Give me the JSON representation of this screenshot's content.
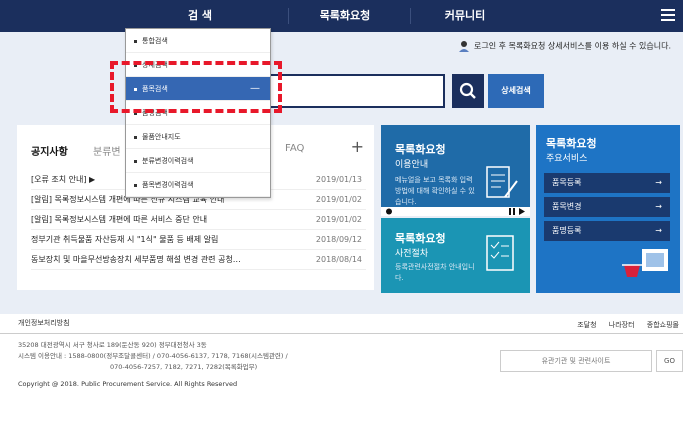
{
  "nav": {
    "items": [
      "검 색",
      "목록화요청",
      "커뮤니티"
    ]
  },
  "login_message": "로그인 후 목록화요청 상세서비스를 이용 하실 수 있습니다.",
  "search": {
    "detail_label": "상세검색"
  },
  "dropdown": {
    "items": [
      "통합검색",
      "상세검색",
      "품목검색",
      "품명검색",
      "물품안내지도",
      "분류변경이력검색",
      "품목변경이력검색"
    ],
    "active_index": 2
  },
  "notice": {
    "tab_active": "공지사항",
    "tab_other": "분류변",
    "tab_faq": "FAQ",
    "rows": [
      {
        "title": "[오류 조치 안내] ▶ ",
        "date": "2019/01/13"
      },
      {
        "title": "[알림] 목록정보시스템 개편에 따른 신규 시스템 교육 안내",
        "date": "2019/01/02"
      },
      {
        "title": "[알림] 목록정보시스템 개편에 따른 서비스 중단 안내",
        "date": "2019/01/02"
      },
      {
        "title": "정부기관 취득물품 자산등재 시 \"1식\" 물품 등 배제 알림",
        "date": "2018/09/12"
      },
      {
        "title": "동보장치 및 마을무선방송장치 세부품명 해설 변경 관련 공청…",
        "date": "2018/08/14"
      }
    ]
  },
  "cards": {
    "guide": {
      "title": "목록화요청",
      "sub": "이용안내",
      "desc": "메뉴얼을 보고 목록화 입력방법에 대해 확인하실 수 있습니다."
    },
    "procedure": {
      "title": "목록화요청",
      "sub": "사전절차",
      "desc": "등록관련사전절차 안내입니다."
    },
    "services": {
      "title": "목록화요청",
      "sub": "주요서비스",
      "buttons": [
        "품목등록",
        "품목변경",
        "품명등록"
      ],
      "arrow": "→"
    }
  },
  "footer": {
    "privacy": "개인정보처리방침",
    "links": [
      "조달청",
      "나라장터",
      "종합쇼핑몰"
    ],
    "address_1": "35208 대전광역시 서구 청사로 189(둔산동 920) 정부대전청사 3동",
    "address_2": "시스템 이용안내 : 1588-0800(정부조달콜센터) / 070-4056-6137, 7178, 7168(시스템관련) /",
    "address_3": "070-4056-7257, 7182, 7271, 7282(목록화업무)",
    "copyright": "Copyright @ 2018. Public Procurement Service. All Rights Reserved",
    "site_select": "유관기관 및 관련사이트",
    "go": "GO"
  },
  "colors": {
    "nav_bg": "#1b2f5d",
    "accent": "#2d6ab7",
    "highlight": "#e8182a"
  }
}
